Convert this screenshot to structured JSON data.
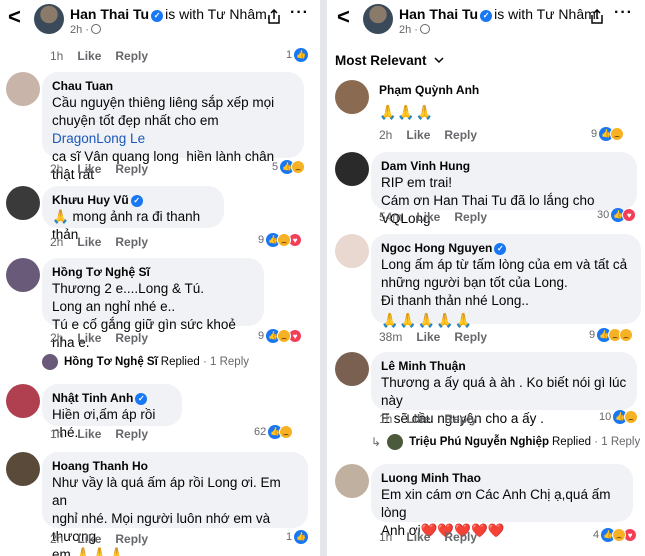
{
  "left": {
    "header": {
      "back": "<",
      "name": "Han Thai Tu",
      "with": "is with Tư Nhâm.",
      "time": "2h ·",
      "menu": "···"
    },
    "top_actions": {
      "time": "1h",
      "like": "Like",
      "reply": "Reply",
      "count": "1"
    },
    "comments": [
      {
        "name": "Chau Tuan",
        "text_pre": "Cầu nguyện thiêng liêng sắp xếp mọi\nchuyện tốt đẹp nhất cho em ",
        "mention": "DragonLong Le",
        "text_post": "\nca sĩ Vân quang long  hiền lành chân thật rất\ncó tâm adidaphat",
        "time": "2h",
        "like": "Like",
        "reply": "Reply",
        "count": "5"
      },
      {
        "name": "Khưu Huy Vũ",
        "text": "🙏 mong ảnh ra đi thanh thản",
        "time": "2h",
        "like": "Like",
        "reply": "Reply",
        "count": "9"
      },
      {
        "name": "Hồng Tơ Nghệ Sĩ",
        "text": "Thương 2 e....Long & Tú.\nLong an nghỉ nhé e..\nTú e cố gắng giữ gìn sức khoẻ nha e.",
        "time": "2h",
        "like": "Like",
        "reply": "Reply",
        "count": "9"
      },
      {
        "name": "Nhật Tinh Anh",
        "text": "Hiền ơi,ấm áp rồi nhé.",
        "time": "1h",
        "like": "Like",
        "reply": "Reply",
        "count": "62"
      },
      {
        "name": "Hoang Thanh Ho",
        "text": "Như vầy là quá ấm áp rồi Long ơi. Em an\nnghỉ nhé. Mọi người luôn nhớ em và thương\nem.🙏🙏🙏",
        "time": "2h",
        "like": "Like",
        "reply": "Reply",
        "count": "1"
      }
    ],
    "replied_line": {
      "name": "Hồng Tơ Nghệ Sĩ",
      "action": "Replied",
      "count": "· 1 Reply"
    }
  },
  "right": {
    "header": {
      "back": "<",
      "name": "Han Thai Tu",
      "with": "is with Tư Nhâm.",
      "time": "2h ·",
      "menu": "···"
    },
    "sort": "Most Relevant",
    "comments": [
      {
        "name": "Phạm Quỳnh Anh",
        "text": "🙏🙏🙏",
        "time": "2h",
        "like": "Like",
        "reply": "Reply",
        "count": "9"
      },
      {
        "name": "Dam Vinh Hung",
        "text": "RIP em trai!\nCám ơn Han Thai Tu đã lo lắng cho VQLong",
        "time": "54m",
        "like": "Like",
        "reply": "Reply",
        "count": "30"
      },
      {
        "name": "Ngoc Hong Nguyen",
        "text": "Long ấm áp từ tấm lòng của em và tất cả\nnhững người bạn tốt của Long.\nĐi thanh thản nhé Long..",
        "emoji": "🙏🙏🙏🙏🙏",
        "time": "38m",
        "like": "Like",
        "reply": "Reply",
        "count": "9"
      },
      {
        "name": "Lê Minh Thuận",
        "text": "Thương a ấy quá à àh . Ko biết nói gì lúc này\nE sẽ cầu nguyện cho a ấy .",
        "time": "1h",
        "like": "Like",
        "reply": "Reply",
        "count": "10"
      },
      {
        "name": "Luong Minh Thao",
        "text": "Em xin cám ơn Các Anh Chị ạ,quá ấm lòng\nAnh ơi❤️❤️❤️❤️❤️",
        "time": "1h",
        "like": "Like",
        "reply": "Reply",
        "count": "4"
      }
    ],
    "replied_line": {
      "name": "Triệu Phú Nguyễn Nghiệp",
      "action": "Replied",
      "count": "· 1 Reply"
    }
  },
  "colors": {
    "accent": "#1877f2",
    "bubble": "#f0f2f5",
    "muted": "#65676b",
    "mention": "#1b57b9"
  }
}
